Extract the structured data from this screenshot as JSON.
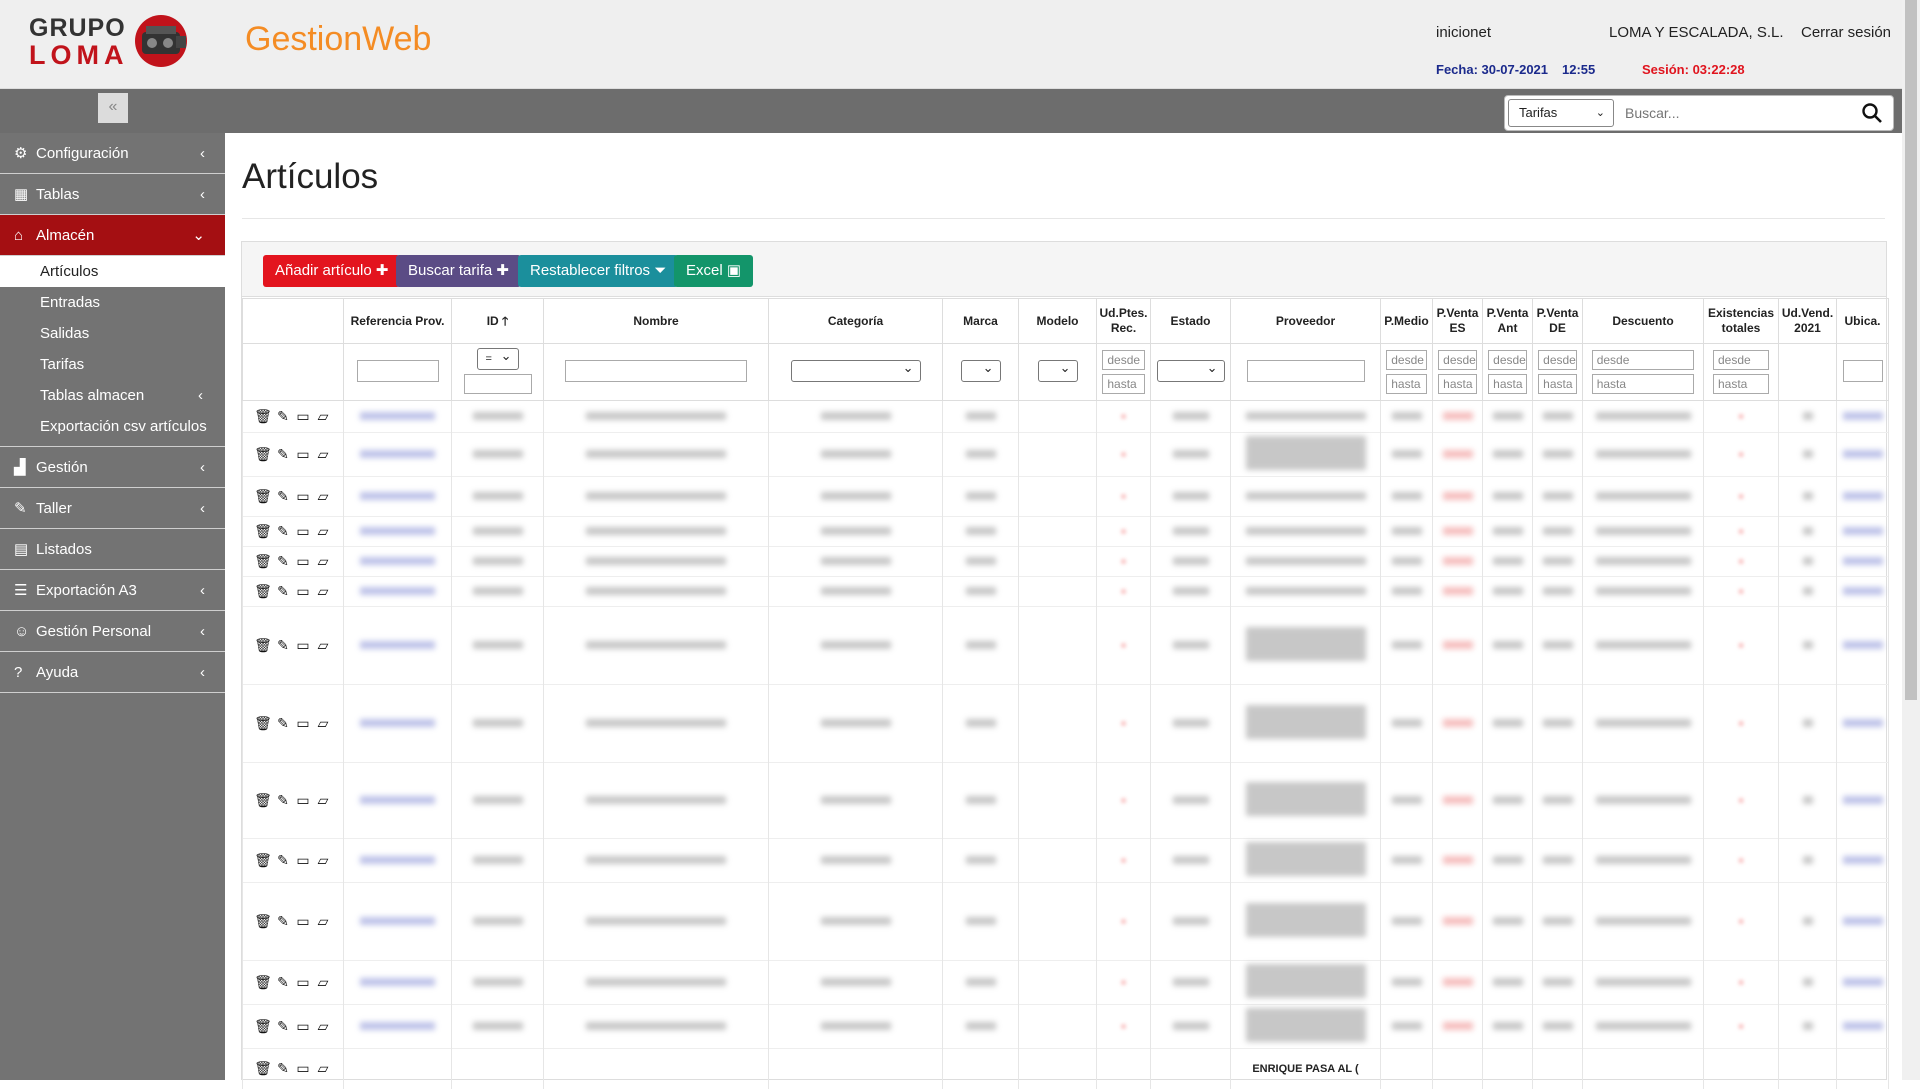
{
  "header": {
    "logo_line1": "GRUPO",
    "logo_line2": "LOMA",
    "app_title": "GestionWeb",
    "user": "inicionet",
    "company": "LOMA Y ESCALADA, S.L.",
    "logout": "Cerrar sesión",
    "date": "Fecha: 30-07-2021",
    "time": "12:55",
    "session": "Sesión: 03:22:28"
  },
  "topbar": {
    "collapse_glyph": "«",
    "search_scope": "Tarifas",
    "search_placeholder": "Buscar..."
  },
  "sidebar": {
    "items": [
      {
        "label": "Configuración",
        "icon": "gear-icon"
      },
      {
        "label": "Tablas",
        "icon": "table-icon"
      },
      {
        "label": "Almacén",
        "icon": "home-icon"
      },
      {
        "label": "Gestión",
        "icon": "chart-icon"
      },
      {
        "label": "Taller",
        "icon": "wrench-icon"
      },
      {
        "label": "Listados",
        "icon": "document-icon"
      },
      {
        "label": "Exportación A3",
        "icon": "database-icon"
      },
      {
        "label": "Gestión Personal",
        "icon": "user-icon"
      },
      {
        "label": "Ayuda",
        "icon": "help-icon"
      }
    ],
    "almacen_sub": [
      "Artículos",
      "Entradas",
      "Salidas",
      "Tarifas",
      "Tablas almacen",
      "Exportación csv artículos"
    ]
  },
  "main": {
    "title": "Artículos",
    "buttons": {
      "add": "Añadir artículo",
      "tarifa": "Buscar tarifa",
      "reset": "Restablecer filtros",
      "excel": "Excel"
    },
    "columns": [
      "",
      "Referencia Prov.",
      "ID",
      "Nombre",
      "Categoría",
      "Marca",
      "Modelo",
      "Ud.Ptes. Rec.",
      "Estado",
      "Proveedor",
      "P.Medio",
      "P.Venta ES",
      "P.Venta Ant",
      "P.Venta DE",
      "Descuento",
      "Existencias totales",
      "Ud.Vend. 2021",
      "Ubica."
    ],
    "filters": {
      "id_operator": "=",
      "desde": "desde",
      "hasta": "hasta"
    },
    "last_row_visible_text": "ENRIQUE   PASA AL ("
  }
}
